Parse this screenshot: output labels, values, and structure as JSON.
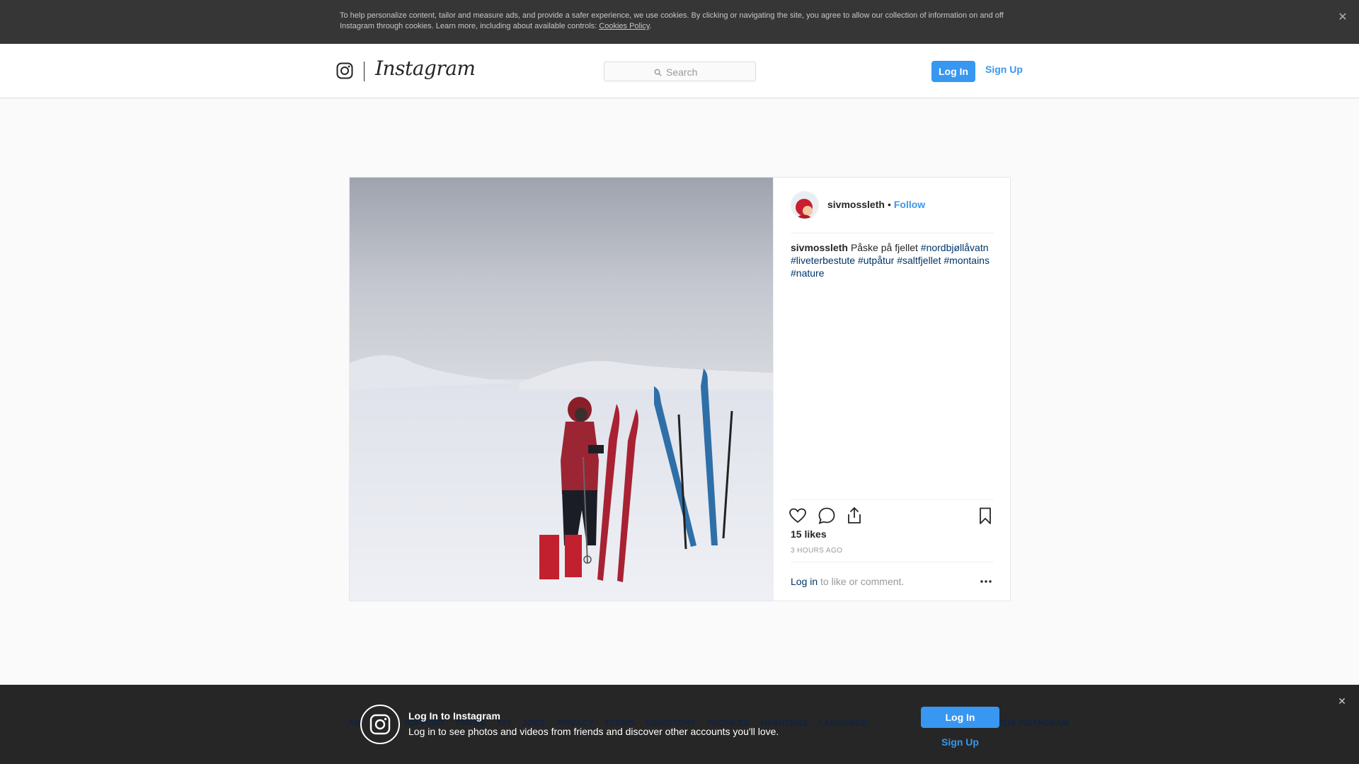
{
  "cookie_banner": {
    "text": "To help personalize content, tailor and measure ads, and provide a safer experience, we use cookies. By clicking or navigating the site, you agree to allow our collection of information on and off Instagram through cookies. Learn more, including about available controls:",
    "link": "Cookies Policy",
    "close_icon": "close-icon"
  },
  "nav": {
    "wordmark": "Instagram",
    "search_placeholder": "Search",
    "login": "Log In",
    "signup": "Sign Up"
  },
  "post": {
    "username": "sivmossleth",
    "separator": "•",
    "follow": "Follow",
    "caption_text": "Påske på fjellet",
    "hashtags": [
      "#nordbjøllåvatn",
      "#liveterbestute",
      "#utpåtur",
      "#saltfjellet",
      "#montains",
      "#nature"
    ],
    "likes": "15 likes",
    "time": "3 HOURS AGO",
    "comment_link": "Log in",
    "comment_text": "to like or comment."
  },
  "footer": {
    "links": [
      "ABOUT US",
      "SUPPORT",
      "PRESS",
      "API",
      "JOBS",
      "PRIVACY",
      "TERMS",
      "DIRECTORY",
      "PROFILES",
      "HASHTAGS",
      "LANGUAGE"
    ],
    "copyright": "© 2018 INSTAGRAM"
  },
  "login_bar": {
    "title": "Log In to Instagram",
    "subtitle": "Log in to see photos and videos from friends and discover other accounts you'll love.",
    "login": "Log In",
    "signup": "Sign Up"
  },
  "colors": {
    "accent": "#3897f0",
    "link": "#003569",
    "banner_bg": "#363636",
    "bottom_bar_bg": "#262626"
  }
}
